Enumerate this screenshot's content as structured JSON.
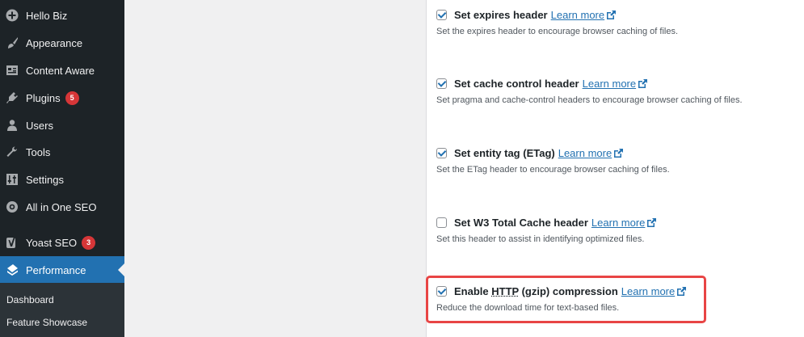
{
  "sidebar": {
    "items": [
      {
        "label": "Hello Biz",
        "icon": "plus-circle-icon"
      },
      {
        "label": "Appearance",
        "icon": "paintbrush-icon"
      },
      {
        "label": "Content Aware",
        "icon": "layout-icon"
      },
      {
        "label": "Plugins",
        "icon": "plugin-icon",
        "badge": "5"
      },
      {
        "label": "Users",
        "icon": "users-icon"
      },
      {
        "label": "Tools",
        "icon": "wrench-icon"
      },
      {
        "label": "Settings",
        "icon": "settings-icon"
      },
      {
        "label": "All in One SEO",
        "icon": "aioseo-icon"
      },
      {
        "label": "Yoast SEO",
        "icon": "yoast-icon",
        "badge": "3"
      },
      {
        "label": "Performance",
        "icon": "performance-icon",
        "active": true
      }
    ],
    "submenu": [
      "Dashboard",
      "Feature Showcase"
    ]
  },
  "options": [
    {
      "label": "Set expires header",
      "link": "Learn more",
      "checked": true,
      "description": "Set the expires header to encourage browser caching of files."
    },
    {
      "label": "Set cache control header",
      "link": "Learn more",
      "checked": true,
      "description": "Set pragma and cache-control headers to encourage browser caching of files."
    },
    {
      "label": "Set entity tag (ETag)",
      "link": "Learn more",
      "checked": true,
      "description": "Set the ETag header to encourage browser caching of files."
    },
    {
      "label": "Set W3 Total Cache header",
      "link": "Learn more",
      "checked": false,
      "description": "Set this header to assist in identifying optimized files."
    },
    {
      "label_prefix": "Enable ",
      "label_abbr": "HTTP",
      "label_suffix": " (gzip) compression",
      "link": "Learn more",
      "checked": true,
      "description": "Reduce the download time for text-based files."
    }
  ],
  "colors": {
    "accent": "#2271b1",
    "highlight": "#e84545",
    "sidebar": "#1d2327"
  }
}
